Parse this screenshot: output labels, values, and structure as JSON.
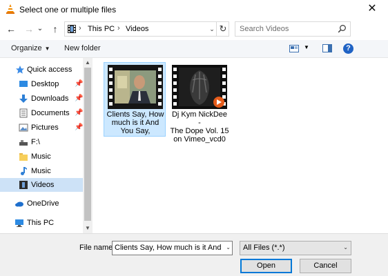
{
  "window": {
    "title": "Select one or multiple files",
    "close_glyph": "✕",
    "app_icon": "vlc-cone-icon"
  },
  "nav": {
    "back_glyph": "←",
    "forward_glyph": "→",
    "recent_glyph": "⌄",
    "up_glyph": "↑",
    "breadcrumb": [
      "This PC",
      "Videos"
    ],
    "crumb_separator": "›",
    "dropdown_glyph": "⌄",
    "refresh_glyph": "↻",
    "search_placeholder": "Search Videos"
  },
  "toolbar": {
    "organize_label": "Organize",
    "organize_caret": "▼",
    "new_folder_label": "New folder",
    "view_caret": "▼",
    "help_glyph": "?"
  },
  "sidebar": {
    "pin_glyph": "📌",
    "items": [
      {
        "label": "Quick access",
        "icon": "star-icon",
        "pinned": false
      },
      {
        "label": "Desktop",
        "icon": "desktop-icon",
        "pinned": true
      },
      {
        "label": "Downloads",
        "icon": "download-arrow-icon",
        "pinned": true
      },
      {
        "label": "Documents",
        "icon": "documents-icon",
        "pinned": true
      },
      {
        "label": "Pictures",
        "icon": "pictures-icon",
        "pinned": true
      },
      {
        "label": "F:\\",
        "icon": "usb-drive-icon",
        "pinned": false
      },
      {
        "label": "Music",
        "icon": "folder-icon",
        "pinned": false
      },
      {
        "label": "Music",
        "icon": "music-note-icon",
        "pinned": false
      },
      {
        "label": "Videos",
        "icon": "videos-icon",
        "pinned": false,
        "selected": true
      },
      {
        "label": "OneDrive",
        "icon": "cloud-icon",
        "pinned": false
      },
      {
        "label": "This PC",
        "icon": "monitor-icon",
        "pinned": false
      }
    ]
  },
  "scrollbar": {
    "up_glyph": "▲",
    "down_glyph": "▼"
  },
  "files": [
    {
      "name_lines": [
        "Clients Say, How",
        "much is it And",
        "You Say,"
      ],
      "selected": true,
      "icon": "video-thumbnail-icon"
    },
    {
      "name_lines": [
        "Dj Kym NickDee -",
        "The Dope Vol. 15",
        "on Vimeo_vcd0"
      ],
      "selected": false,
      "icon": "video-thumbnail-icon"
    }
  ],
  "footer": {
    "file_name_label": "File name:",
    "file_name_value": "Clients Say, How much is it And You",
    "file_name_caret": "⌄",
    "file_type_value": "All Files (*.*)",
    "file_type_caret": "⌄",
    "open_label": "Open",
    "cancel_label": "Cancel"
  },
  "colors": {
    "accent": "#0078d7",
    "selection": "#cce8ff",
    "nav_selection": "#cde2f7",
    "help": "#1f62c4"
  }
}
